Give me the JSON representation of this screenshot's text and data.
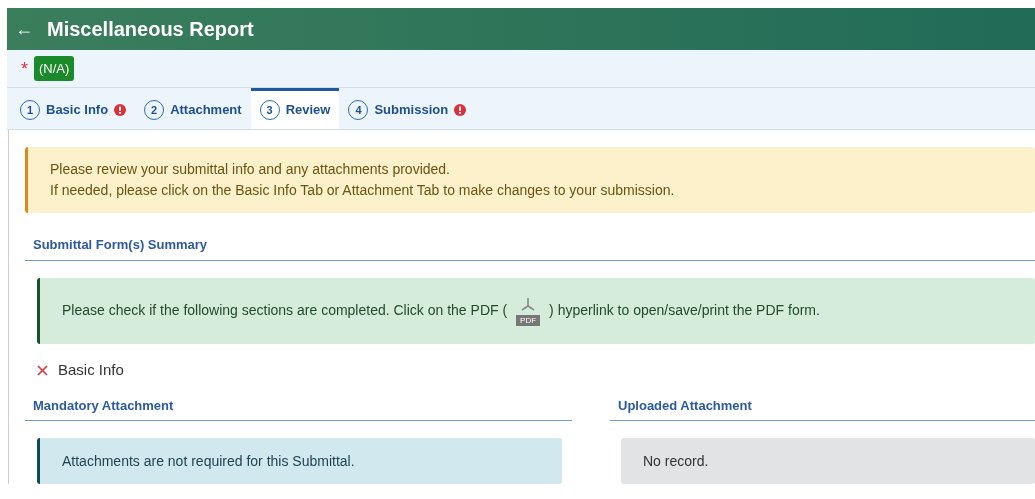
{
  "header": {
    "back": "←",
    "title": "Miscellaneous Report"
  },
  "status": {
    "required_mark": "*",
    "badge": "(N/A)"
  },
  "tabs": [
    {
      "number": "1",
      "label": "Basic Info",
      "error": true,
      "selected": false
    },
    {
      "number": "2",
      "label": "Attachment",
      "error": false,
      "selected": false
    },
    {
      "number": "3",
      "label": "Review",
      "error": false,
      "selected": true
    },
    {
      "number": "4",
      "label": "Submission",
      "error": true,
      "selected": false
    }
  ],
  "notice": [
    "Please review your submittal info and any attachments provided.",
    "If needed, please click on the Basic Info Tab or Attachment Tab to make changes to your submission."
  ],
  "summary": {
    "heading": "Submittal Form(s) Summary",
    "message_before": "Please check if the following sections are completed. Click on the PDF (",
    "pdf_label": "PDF",
    "message_after": ") hyperlink to open/save/print the PDF form.",
    "sections": [
      {
        "label": "Basic Info",
        "complete": false
      }
    ]
  },
  "mandatory": {
    "heading": "Mandatory Attachment",
    "message": "Attachments are not required for this Submittal."
  },
  "uploaded": {
    "heading": "Uploaded Attachment",
    "message": "No record."
  }
}
